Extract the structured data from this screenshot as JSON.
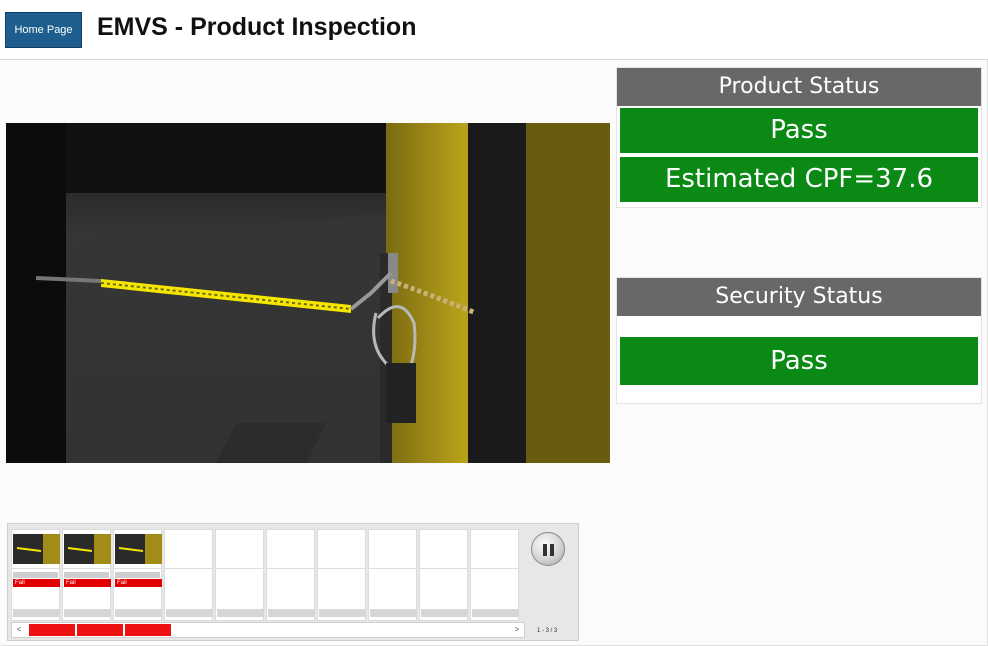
{
  "header": {
    "home_button": "Home Page",
    "title": "EMVS - Product Inspection"
  },
  "product_status": {
    "title": "Product Status",
    "result": "Pass",
    "estimate": "Estimated CPF=37.6",
    "result_color": "#0a8a14"
  },
  "security_status": {
    "title": "Security Status",
    "result": "Pass",
    "result_color": "#0a8a14"
  },
  "filmstrip": {
    "captures": [
      {
        "label": "Fail"
      },
      {
        "label": "Fail"
      },
      {
        "label": "Fail"
      }
    ],
    "empty_slots": 7,
    "fail_color": "#e00000",
    "pause_icon": "pause-icon",
    "scroll_left": "<",
    "scroll_right": ">",
    "page_counter": "1 - 3 / 3"
  }
}
